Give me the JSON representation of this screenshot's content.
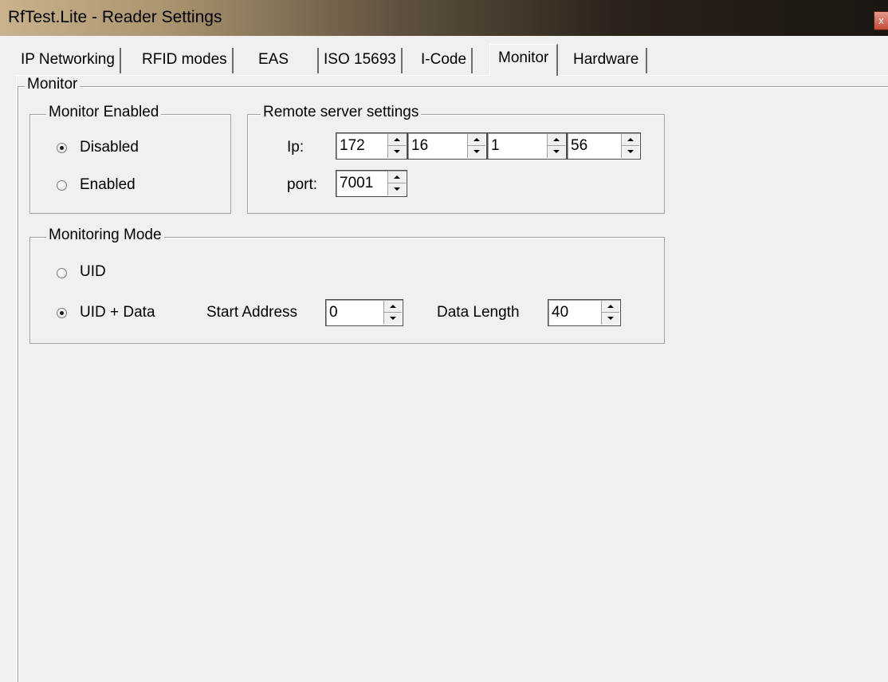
{
  "window": {
    "title": "RfTest.Lite - Reader Settings",
    "close_glyph": "x"
  },
  "tabs": [
    {
      "label": "IP Networking"
    },
    {
      "label": "RFID modes"
    },
    {
      "label": "EAS"
    },
    {
      "label": "ISO 15693"
    },
    {
      "label": "I-Code"
    },
    {
      "label": "Monitor",
      "active": true
    },
    {
      "label": "Hardware"
    }
  ],
  "monitor": {
    "legend": "Monitor",
    "enabled_group": {
      "legend": "Monitor Enabled",
      "options": [
        "Disabled",
        "Enabled"
      ],
      "selected": "Disabled"
    },
    "remote_server": {
      "legend": "Remote server settings",
      "ip_label": "Ip:",
      "ip_octets": [
        "172",
        "16",
        "1",
        "56"
      ],
      "port_label": "port:",
      "port": "7001"
    },
    "mode_group": {
      "legend": "Monitoring Mode",
      "options": [
        "UID",
        "UID + Data"
      ],
      "selected": "UID + Data",
      "start_address_label": "Start Address",
      "start_address": "0",
      "data_length_label": "Data Length",
      "data_length": "40"
    }
  }
}
